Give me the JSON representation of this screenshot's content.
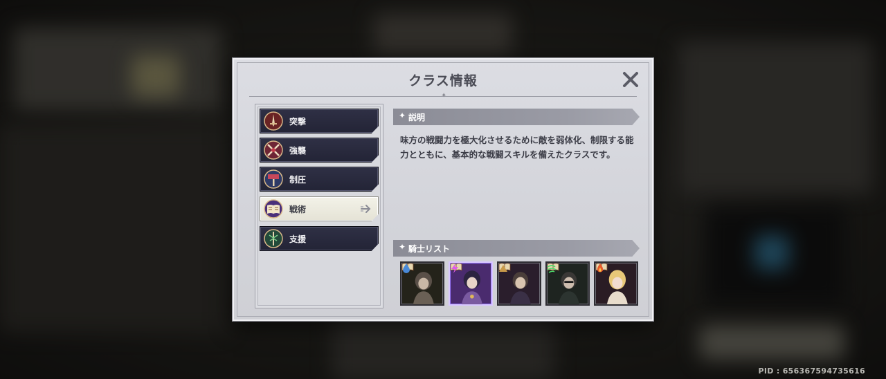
{
  "modal": {
    "title": "クラス情報"
  },
  "classes": [
    {
      "label": "突撃",
      "icon": "sword-crest-icon",
      "color": "#8a2a2a",
      "active": false
    },
    {
      "label": "強襲",
      "icon": "crossed-blades-icon",
      "color": "#7a2b3a",
      "active": false
    },
    {
      "label": "制圧",
      "icon": "hammer-crest-icon",
      "color": "#3c4a7a",
      "active": false
    },
    {
      "label": "戦術",
      "icon": "open-book-icon",
      "color": "#5a3a8a",
      "active": true
    },
    {
      "label": "支援",
      "icon": "staff-crest-icon",
      "color": "#2f6a4a",
      "active": false
    }
  ],
  "description": {
    "heading": "説明",
    "text": "味方の戦闘力を極大化させるために敵を弱体化、制限する能力とともに、基本的な戦闘スキルを備えたクラスです。"
  },
  "knights": {
    "heading": "騎士リスト",
    "items": [
      {
        "element": "water-drop-icon",
        "bg": "#2a2a1e",
        "selected": false
      },
      {
        "element": "lightning-icon",
        "bg": "#4a2b6e",
        "selected": true
      },
      {
        "element": "earth-pyramid-icon",
        "bg": "#2a1e2c",
        "selected": false
      },
      {
        "element": "wind-swirl-icon",
        "bg": "#1e2420",
        "selected": false
      },
      {
        "element": "fire-flame-icon",
        "bg": "#2a1c24",
        "selected": false
      }
    ]
  },
  "footer": {
    "pid": "PID : 656367594735616"
  },
  "colors": {
    "accent": "#9a78ff",
    "button_dark": "#2a2b3f",
    "button_active": "#eceadf"
  }
}
